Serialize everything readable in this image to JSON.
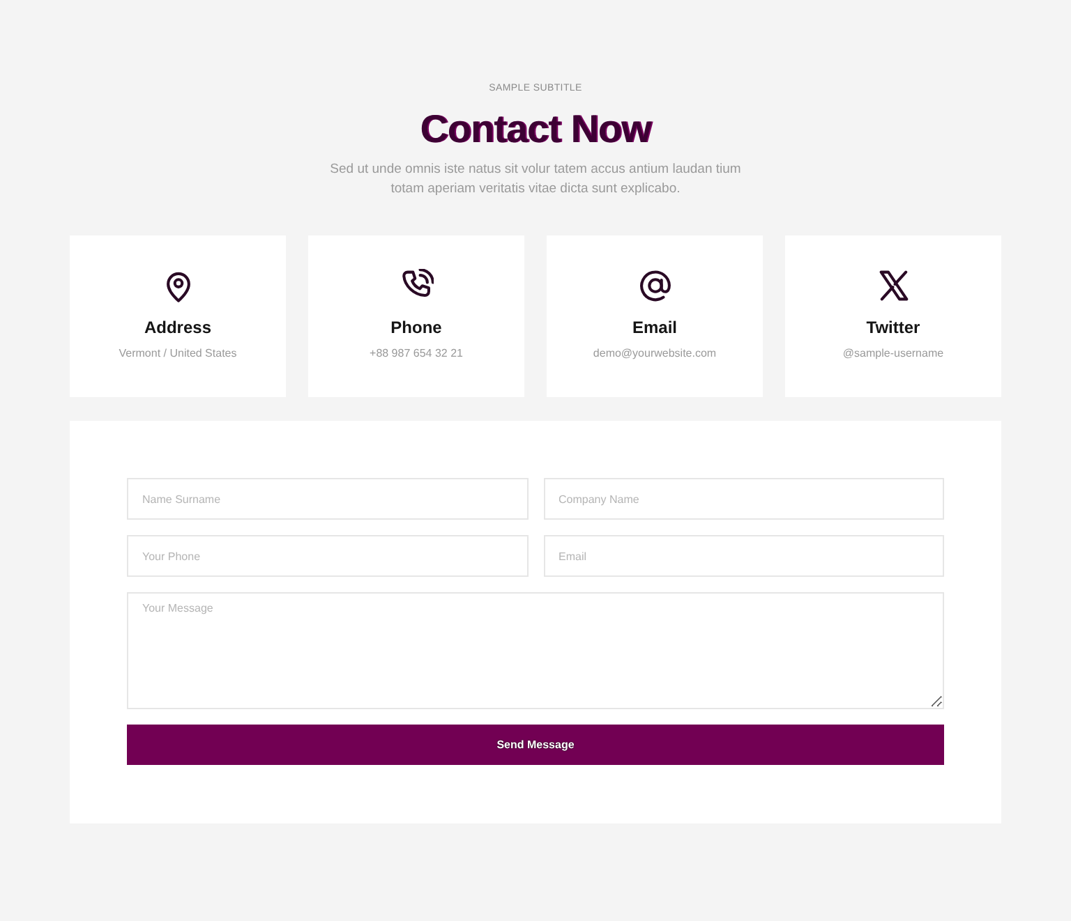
{
  "header": {
    "subtitle": "SAMPLE SUBTITLE",
    "title": "Contact Now",
    "description": "Sed ut unde omnis iste natus sit volur tatem accus antium laudan tium totam aperiam veritatis vitae dicta sunt explicabo."
  },
  "contact_cards": [
    {
      "kind": "location",
      "title": "Address",
      "value": "Vermont / United States"
    },
    {
      "kind": "phone",
      "title": "Phone",
      "value": "+88 987 654 32 21"
    },
    {
      "kind": "email",
      "title": "Email",
      "value": "demo@yourwebsite.com"
    },
    {
      "kind": "x",
      "title": "Twitter",
      "value": "@sample-username"
    }
  ],
  "form": {
    "fields": [
      {
        "kind": "input",
        "placeholder": "Name Surname"
      },
      {
        "kind": "input",
        "placeholder": "Company Name"
      },
      {
        "kind": "input",
        "placeholder": "Your Phone"
      },
      {
        "kind": "input",
        "placeholder": "Email"
      },
      {
        "kind": "textarea",
        "placeholder": "Your Message"
      }
    ],
    "submit": "Send Message"
  }
}
